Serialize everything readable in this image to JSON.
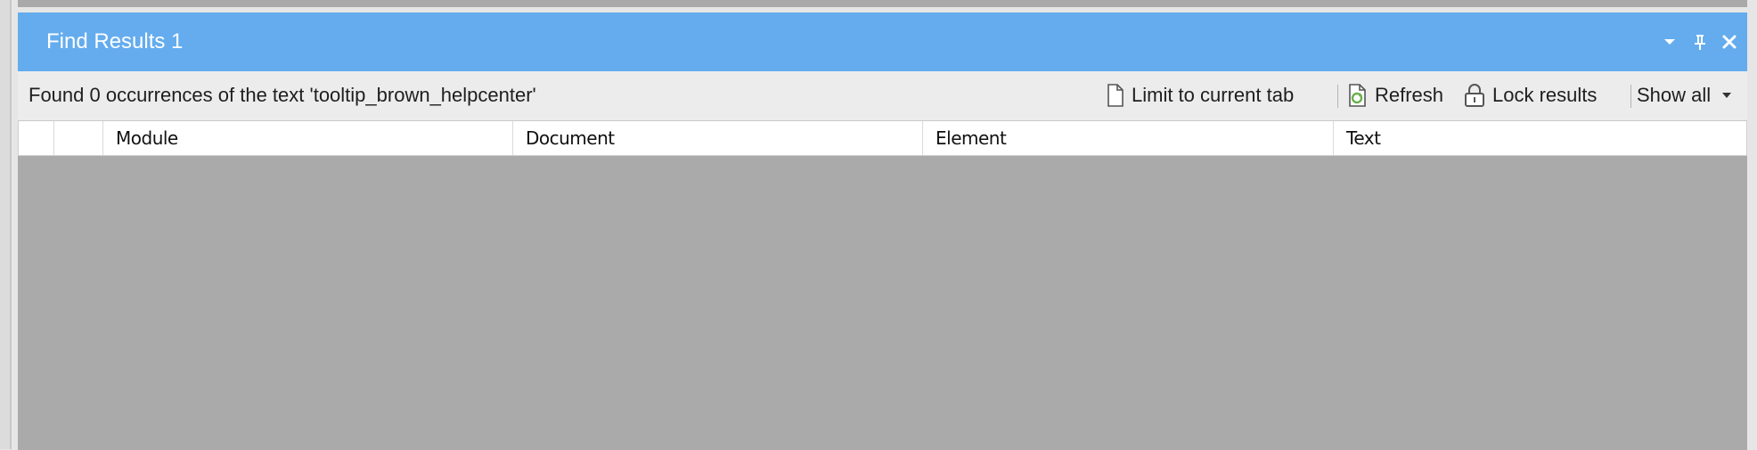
{
  "window": {
    "title": "Find Results 1",
    "controls": {
      "dropdown": "chevron-down-icon",
      "pin": "pin-icon",
      "close": "close-icon"
    }
  },
  "toolbar": {
    "status": "Found 0 occurrences of the text 'tooltip_brown_helpcenter'",
    "limit_label": "Limit to current tab",
    "refresh_label": "Refresh",
    "lock_label": "Lock results",
    "show_all_label": "Show all"
  },
  "table": {
    "columns": [
      "",
      "",
      "Module",
      "Document",
      "Element",
      "Text"
    ],
    "rows": []
  },
  "colors": {
    "titlebar": "#64acee",
    "grid_background": "#aaaaaa",
    "toolbar_background": "#ececec"
  }
}
